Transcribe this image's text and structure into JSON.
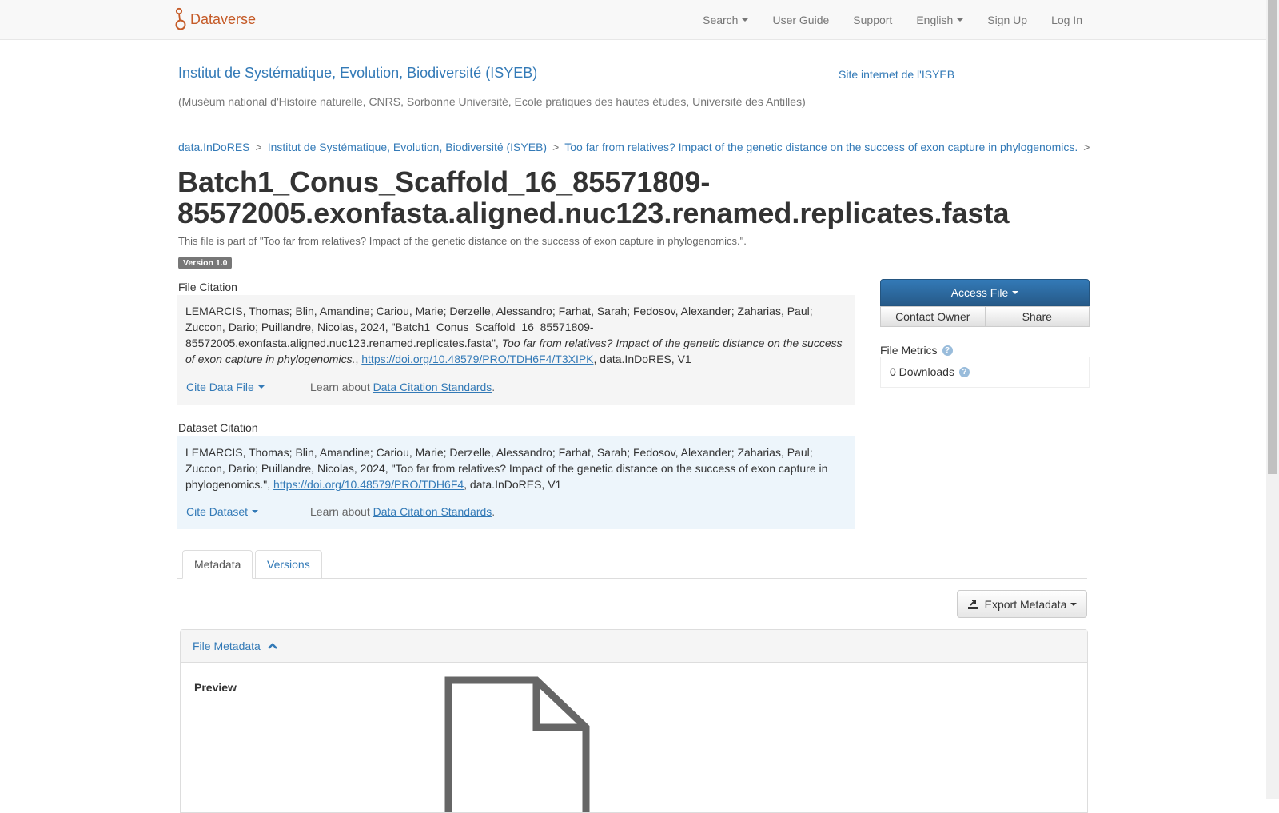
{
  "navbar": {
    "brand": "Dataverse",
    "items": [
      {
        "label": "Search",
        "dropdown": true
      },
      {
        "label": "User Guide",
        "dropdown": false
      },
      {
        "label": "Support",
        "dropdown": false
      },
      {
        "label": "English",
        "dropdown": true
      },
      {
        "label": "Sign Up",
        "dropdown": false
      },
      {
        "label": "Log In",
        "dropdown": false
      }
    ]
  },
  "dataverse": {
    "name": "Institut de Systématique, Evolution, Biodiversité (ISYEB)",
    "site_link": "Site internet de l'ISYEB",
    "affiliation": "(Muséum national d'Histoire naturelle, CNRS, Sorbonne Université, Ecole pratiques des hautes études, Université des Antilles)"
  },
  "breadcrumb": [
    "data.InDoRES",
    "Institut de Systématique, Evolution, Biodiversité (ISYEB)",
    "Too far from relatives? Impact of the genetic distance on the success of exon capture in phylogenomics."
  ],
  "file": {
    "title_line1": "Batch1_Conus_Scaffold_16_85571809-",
    "title_line2": "85572005.exonfasta.aligned.nuc123.renamed.replicates.fasta",
    "part_of": "This file is part of \"Too far from relatives? Impact of the genetic distance on the success of exon capture in phylogenomics.\".",
    "version": "Version 1.0"
  },
  "file_citation": {
    "label": "File Citation",
    "text_before": "LEMARCIS, Thomas; Blin, Amandine; Cariou, Marie; Derzelle, Alessandro; Farhat, Sarah; Fedosov, Alexander; Zaharias, Paul; Zuccon, Dario; Puillandre, Nicolas, 2024, \"Batch1_Conus_Scaffold_16_85571809-85572005.exonfasta.aligned.nuc123.renamed.replicates.fasta\", ",
    "italic": "Too far from relatives? Impact of the genetic distance on the success of exon capture in phylogenomics.",
    "sep": ", ",
    "doi": "https://doi.org/10.48579/PRO/TDH6F4/T3XIPK",
    "text_after": ", data.InDoRES, V1",
    "cite_button": "Cite Data File",
    "learn_prefix": "Learn about ",
    "learn_link": "Data Citation Standards",
    "learn_suffix": "."
  },
  "dataset_citation": {
    "label": "Dataset Citation",
    "text_before": "LEMARCIS, Thomas; Blin, Amandine; Cariou, Marie; Derzelle, Alessandro; Farhat, Sarah; Fedosov, Alexander; Zaharias, Paul; Zuccon, Dario; Puillandre, Nicolas, 2024, \"Too far from relatives? Impact of the genetic distance on the success of exon capture in phylogenomics.\", ",
    "doi": "https://doi.org/10.48579/PRO/TDH6F4",
    "text_after": ", data.InDoRES, V1",
    "cite_button": "Cite Dataset",
    "learn_prefix": "Learn about ",
    "learn_link": "Data Citation Standards",
    "learn_suffix": "."
  },
  "actions": {
    "access_file": "Access File",
    "contact_owner": "Contact Owner",
    "share": "Share"
  },
  "metrics": {
    "label": "File Metrics",
    "downloads": "0 Downloads"
  },
  "tabs": [
    {
      "label": "Metadata",
      "active": true
    },
    {
      "label": "Versions",
      "active": false
    }
  ],
  "export_button": "Export Metadata",
  "panel": {
    "title": "File Metadata",
    "preview_label": "Preview"
  },
  "icons": {
    "brand": "dataverse-logo-icon",
    "help": "question-circle-icon",
    "export": "export-icon",
    "chevron": "chevron-up-icon",
    "file": "file-icon"
  },
  "colors": {
    "brand": "#c55b28",
    "link": "#337ab7",
    "primary_button": "#337ab7",
    "dataset_citation_bg": "#edf5fb",
    "file_citation_bg": "#f5f5f5"
  }
}
